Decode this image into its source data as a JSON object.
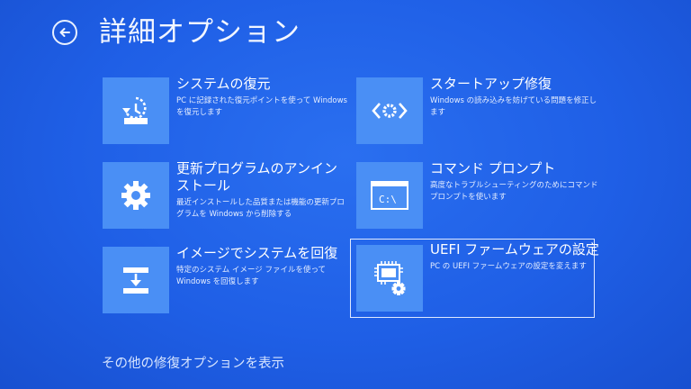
{
  "header": {
    "title": "詳細オプション"
  },
  "tiles": [
    {
      "title": "システムの復元",
      "desc": "PC に記録された復元ポイントを使って Windows を復元します",
      "icon": "system-restore-icon"
    },
    {
      "title": "スタートアップ修復",
      "desc": "Windows の読み込みを妨げている問題を修正します",
      "icon": "startup-repair-icon"
    },
    {
      "title": "更新プログラムのアンインストール",
      "desc": "最近インストールした品質または機能の更新プログラムを Windows から削除する",
      "icon": "gear-icon"
    },
    {
      "title": "コマンド プロンプト",
      "desc": "高度なトラブルシューティングのためにコマンドプロンプトを使います",
      "icon": "command-prompt-icon",
      "prompt_text": "C:\\"
    },
    {
      "title": "イメージでシステムを回復",
      "desc": "特定のシステム イメージ ファイルを使って Windows を回復します",
      "icon": "system-image-recovery-icon"
    },
    {
      "title": "UEFI ファームウェアの設定",
      "desc": "PC の UEFI ファームウェアの設定を変えます",
      "icon": "uefi-firmware-icon"
    }
  ],
  "footer": {
    "more_options": "その他の修復オプションを表示"
  }
}
